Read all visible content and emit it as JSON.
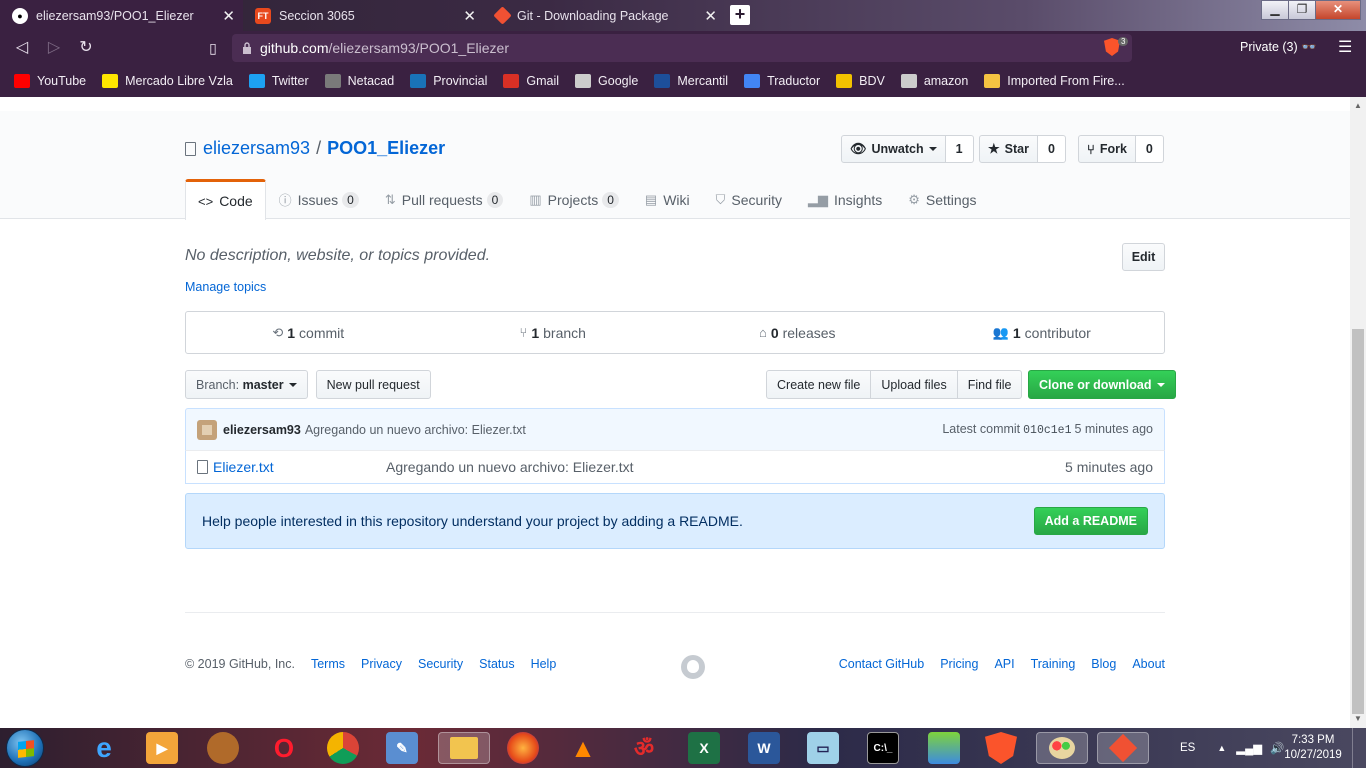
{
  "browser": {
    "tabs": [
      {
        "title": "eliezersam93/POO1_Eliezer",
        "active": true
      },
      {
        "title": "Seccion 3065",
        "active": false
      },
      {
        "title": "Git - Downloading Package",
        "active": false
      }
    ],
    "url_host": "github.com",
    "url_path": "/eliezersam93/POO1_Eliezer",
    "shield_count": "3",
    "private_label": "Private (3)",
    "bookmarks": [
      {
        "label": "YouTube",
        "icon": "youtube-icon",
        "color": "#ff0000"
      },
      {
        "label": "Mercado Libre Vzla",
        "icon": "mercadolibre-icon",
        "color": "#ffe600"
      },
      {
        "label": "Twitter",
        "icon": "twitter-icon",
        "color": "#1da1f2"
      },
      {
        "label": "Netacad",
        "icon": "cisco-icon",
        "color": "#7a7a7a"
      },
      {
        "label": "Provincial",
        "icon": "provincial-icon",
        "color": "#1973b8"
      },
      {
        "label": "Gmail",
        "icon": "gmail-icon",
        "color": "#d93025"
      },
      {
        "label": "Google",
        "icon": "globe-icon",
        "color": "#cccccc"
      },
      {
        "label": "Mercantil",
        "icon": "mercantil-icon",
        "color": "#1d4f9a"
      },
      {
        "label": "Traductor",
        "icon": "translate-icon",
        "color": "#4285f4"
      },
      {
        "label": "BDV",
        "icon": "bdv-icon",
        "color": "#f2c200"
      },
      {
        "label": "amazon",
        "icon": "globe-icon",
        "color": "#cccccc"
      },
      {
        "label": "Imported From Fire...",
        "icon": "folder-icon",
        "color": "#f5c342"
      }
    ]
  },
  "repo": {
    "owner": "eliezersam93",
    "name": "POO1_Eliezer",
    "unwatch_label": "Unwatch",
    "watch_count": "1",
    "star_label": "Star",
    "star_count": "0",
    "fork_label": "Fork",
    "fork_count": "0"
  },
  "nav": {
    "code": "Code",
    "issues": "Issues",
    "issues_count": "0",
    "pulls": "Pull requests",
    "pulls_count": "0",
    "projects": "Projects",
    "projects_count": "0",
    "wiki": "Wiki",
    "security": "Security",
    "insights": "Insights",
    "settings": "Settings"
  },
  "summary": {
    "description": "No description, website, or topics provided.",
    "edit_label": "Edit",
    "manage_topics": "Manage topics",
    "commits_num": "1",
    "commits_label": "commit",
    "branches_num": "1",
    "branches_label": "branch",
    "releases_num": "0",
    "releases_label": "releases",
    "contributors_num": "1",
    "contributors_label": "contributor"
  },
  "filenav": {
    "branch_prefix": "Branch:",
    "branch_name": "master",
    "new_pr": "New pull request",
    "create_file": "Create new file",
    "upload_files": "Upload files",
    "find_file": "Find file",
    "clone": "Clone or download"
  },
  "commit": {
    "author": "eliezersam93",
    "message": "Agregando un nuevo archivo: Eliezer.txt",
    "latest_label": "Latest commit",
    "sha": "010c1e1",
    "age": "5 minutes ago"
  },
  "files": [
    {
      "name": "Eliezer.txt",
      "message": "Agregando un nuevo archivo: Eliezer.txt",
      "age": "5 minutes ago"
    }
  ],
  "readme_prompt": {
    "text": "Help people interested in this repository understand your project by adding a README.",
    "button": "Add a README"
  },
  "footer": {
    "copyright": "© 2019 GitHub, Inc.",
    "left_links": [
      "Terms",
      "Privacy",
      "Security",
      "Status",
      "Help"
    ],
    "right_links": [
      "Contact GitHub",
      "Pricing",
      "API",
      "Training",
      "Blog",
      "About"
    ]
  },
  "taskbar": {
    "language": "ES",
    "time": "7:33 PM",
    "date": "10/27/2019"
  }
}
